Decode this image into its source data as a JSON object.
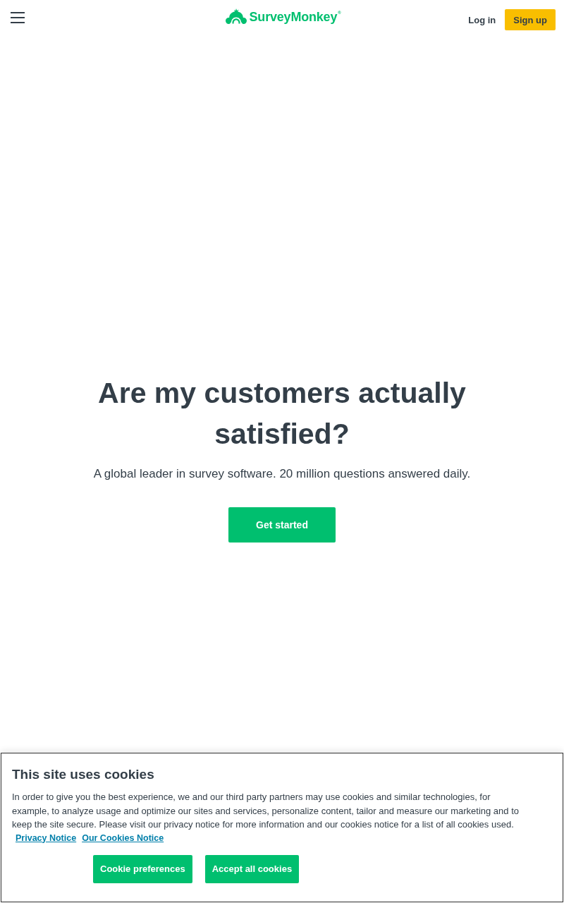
{
  "header": {
    "logo": "SurveyMonkey$^{®}$",
    "login": "Log in",
    "signup": "Sign up"
  },
  "hero": {
    "title": "Are my customers actually satisfied?",
    "subtitle": "A global leader in survey software. 20 million questions answered daily.",
    "button": "Get started"
  },
  "cookie_banner": {
    "title": "This site uses cookies",
    "text": "In order to give you the best experience, we and our third party partners may use cookies and similar technologies, for example, to analyze usage and optimize our sites and services, personalize content, tailor and measure our marketing and to keep the site secure. Please visit our privacy notice for more information and our cookies notice for a list of all cookies used.",
    "links": [
      "Privacy Notice",
      "Our Cookies Notice"
    ],
    "buttons": [
      "Cookie preferences",
      "Accept all cookies"
    ]
  }
}
